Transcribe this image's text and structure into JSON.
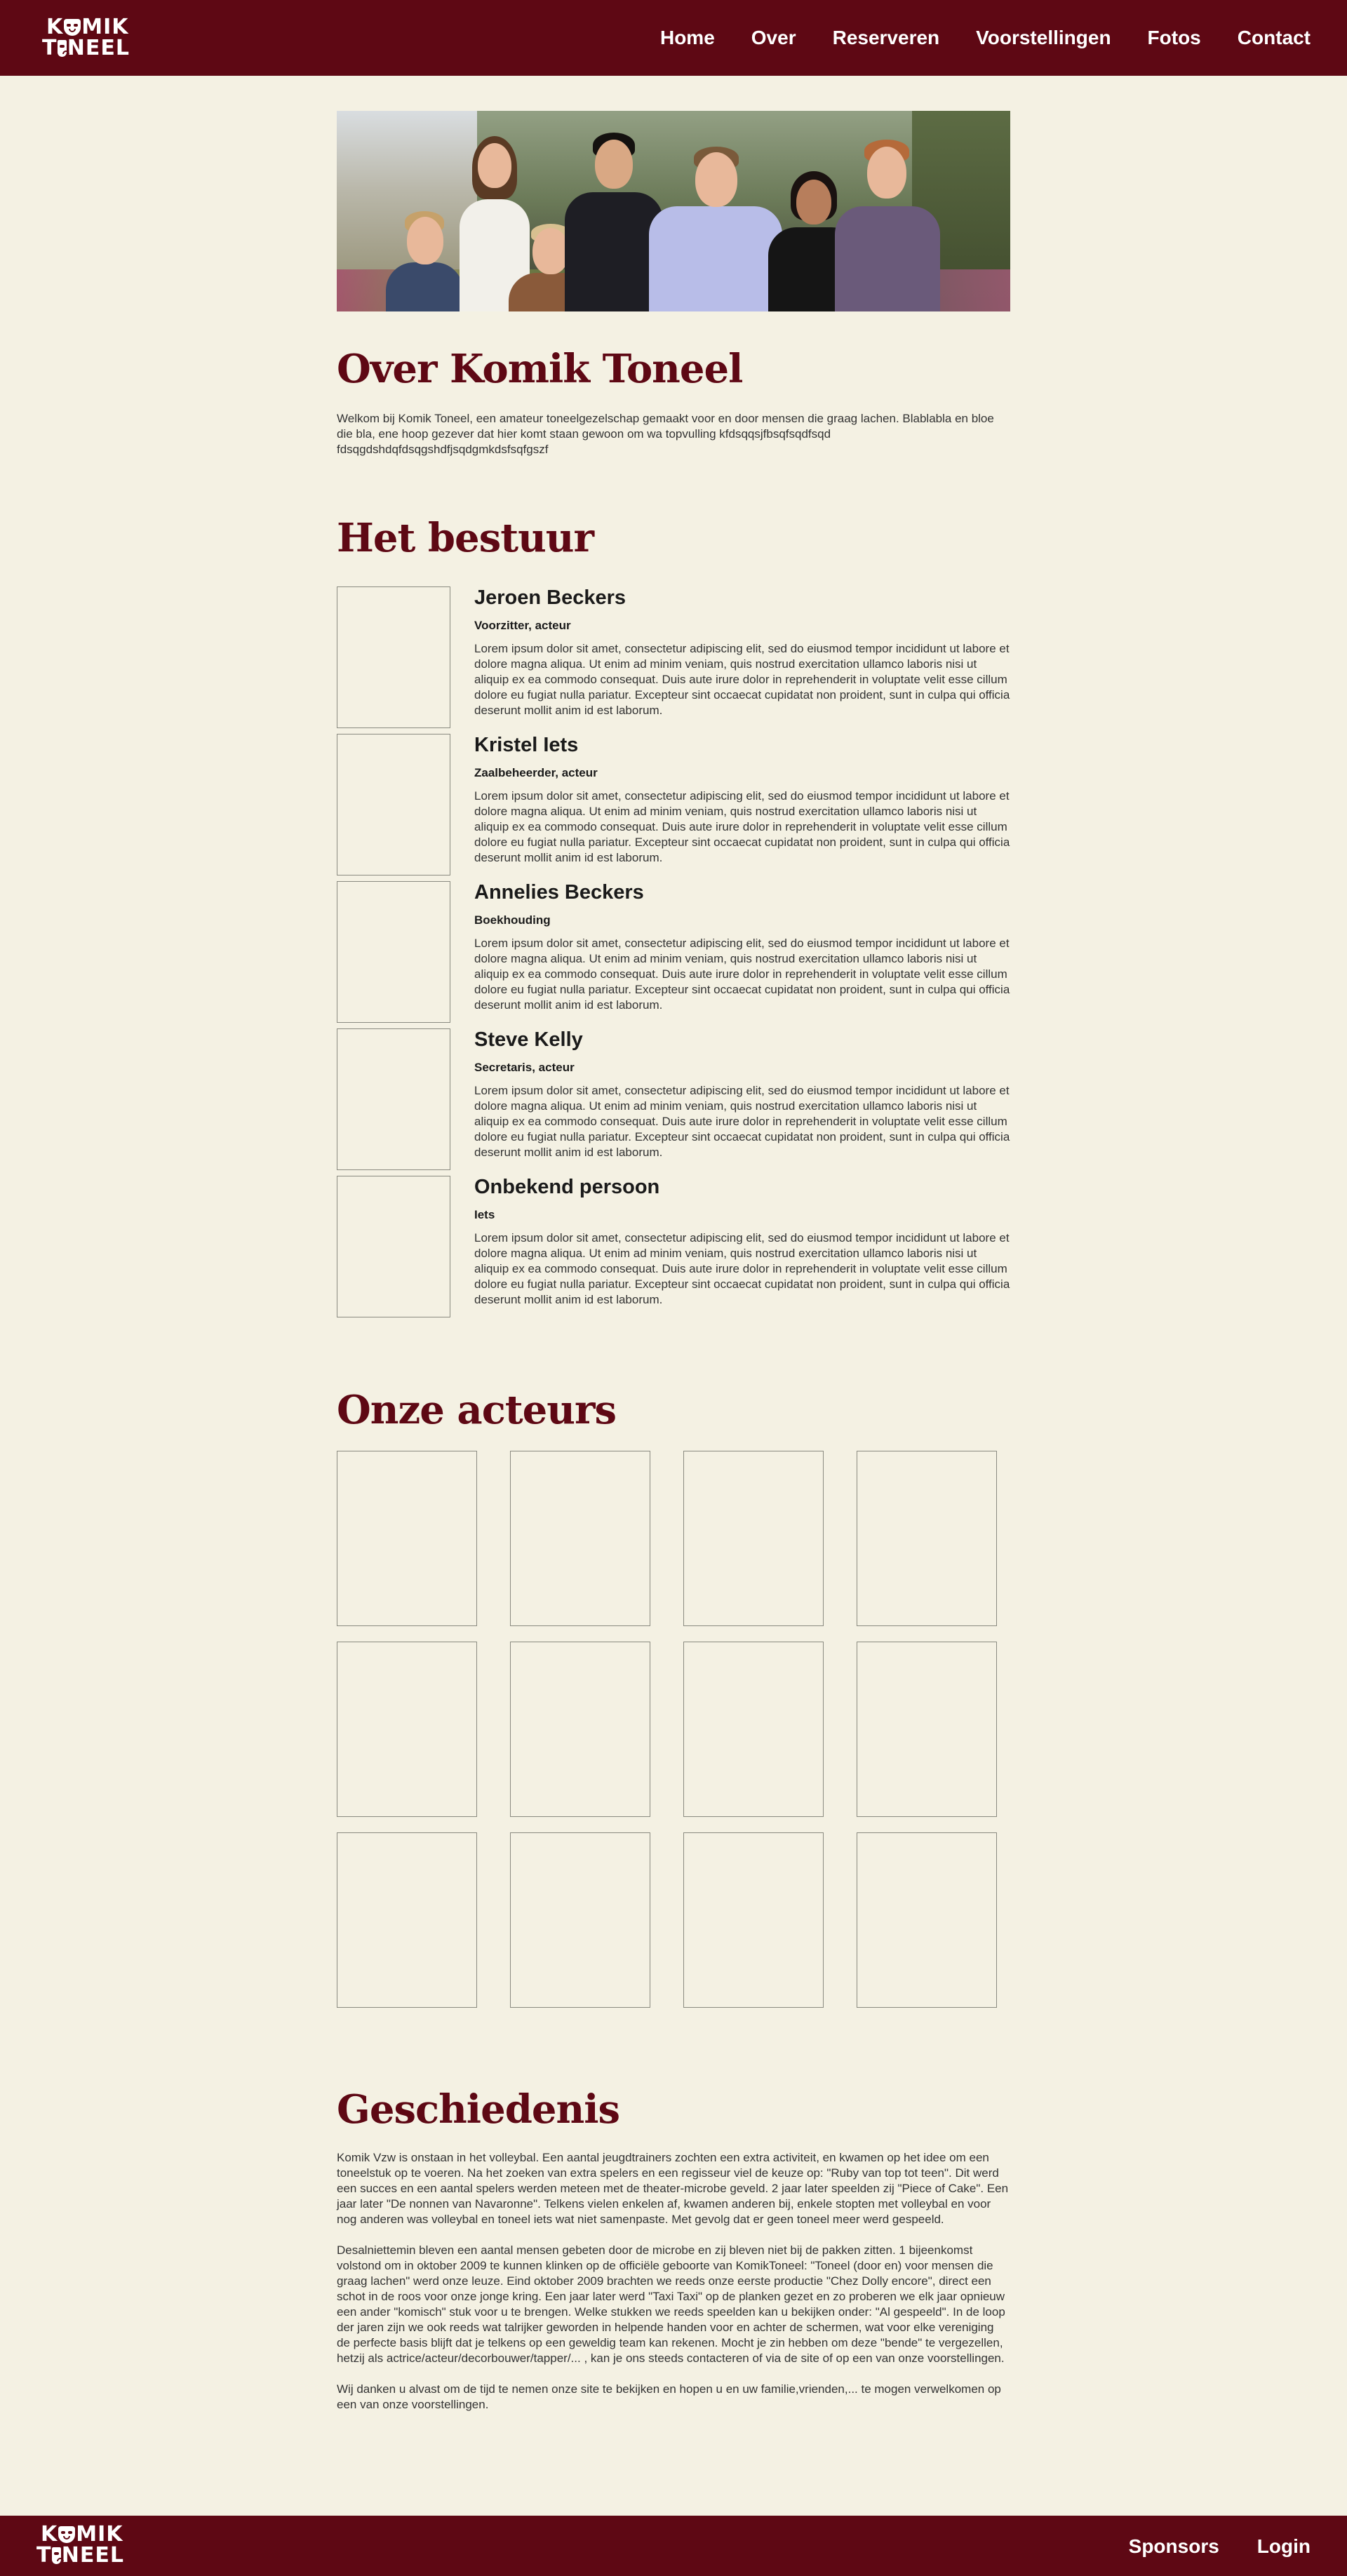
{
  "header": {
    "logo_line1_a": "K",
    "logo_line1_b": "MIK",
    "logo_line2_a": "T",
    "logo_line2_b": "NEEL",
    "nav": [
      "Home",
      "Over",
      "Reserveren",
      "Voorstellingen",
      "Fotos",
      "Contact"
    ]
  },
  "about": {
    "title": "Over Komik Toneel",
    "text": "Welkom bij Komik Toneel, een amateur toneelgezelschap gemaakt voor en door mensen die graag lachen. Blablabla en bloe die bla, ene hoop gezever dat hier komt staan gewoon om wa topvulling kfdsqqsjfbsqfsqdfsqd fdsqgdshdqfdsqgshdfjsqdgmkdsfsqfgszf"
  },
  "board": {
    "title": "Het bestuur",
    "members": [
      {
        "name": "Jeroen Beckers",
        "role": "Voorzitter, acteur",
        "desc": "Lorem ipsum dolor sit amet, consectetur adipiscing elit, sed do eiusmod tempor incididunt ut labore et dolore magna aliqua. Ut enim ad minim veniam, quis nostrud exercitation ullamco laboris nisi ut aliquip ex ea commodo consequat. Duis aute irure dolor in reprehenderit in voluptate velit esse cillum dolore eu fugiat nulla pariatur. Excepteur sint occaecat cupidatat non proident, sunt in culpa qui officia deserunt mollit anim id est laborum."
      },
      {
        "name": "Kristel Iets",
        "role": "Zaalbeheerder, acteur",
        "desc": "Lorem ipsum dolor sit amet, consectetur adipiscing elit, sed do eiusmod tempor incididunt ut labore et dolore magna aliqua. Ut enim ad minim veniam, quis nostrud exercitation ullamco laboris nisi ut aliquip ex ea commodo consequat. Duis aute irure dolor in reprehenderit in voluptate velit esse cillum dolore eu fugiat nulla pariatur. Excepteur sint occaecat cupidatat non proident, sunt in culpa qui officia deserunt mollit anim id est laborum."
      },
      {
        "name": "Annelies Beckers",
        "role": "Boekhouding",
        "desc": "Lorem ipsum dolor sit amet, consectetur adipiscing elit, sed do eiusmod tempor incididunt ut labore et dolore magna aliqua. Ut enim ad minim veniam, quis nostrud exercitation ullamco laboris nisi ut aliquip ex ea commodo consequat. Duis aute irure dolor in reprehenderit in voluptate velit esse cillum dolore eu fugiat nulla pariatur. Excepteur sint occaecat cupidatat non proident, sunt in culpa qui officia deserunt mollit anim id est laborum."
      },
      {
        "name": "Steve Kelly",
        "role": "Secretaris, acteur",
        "desc": "Lorem ipsum dolor sit amet, consectetur adipiscing elit, sed do eiusmod tempor incididunt ut labore et dolore magna aliqua. Ut enim ad minim veniam, quis nostrud exercitation ullamco laboris nisi ut aliquip ex ea commodo consequat. Duis aute irure dolor in reprehenderit in voluptate velit esse cillum dolore eu fugiat nulla pariatur. Excepteur sint occaecat cupidatat non proident, sunt in culpa qui officia deserunt mollit anim id est laborum."
      },
      {
        "name": "Onbekend persoon",
        "role": "Iets",
        "desc": "Lorem ipsum dolor sit amet, consectetur adipiscing elit, sed do eiusmod tempor incididunt ut labore et dolore magna aliqua. Ut enim ad minim veniam, quis nostrud exercitation ullamco laboris nisi ut aliquip ex ea commodo consequat. Duis aute irure dolor in reprehenderit in voluptate velit esse cillum dolore eu fugiat nulla pariatur. Excepteur sint occaecat cupidatat non proident, sunt in culpa qui officia deserunt mollit anim id est laborum."
      }
    ]
  },
  "actors": {
    "title": "Onze acteurs"
  },
  "history": {
    "title": "Geschiedenis",
    "paragraphs": [
      " Komik Vzw is onstaan in het volleybal. Een aantal jeugdtrainers zochten een extra activiteit, en kwamen op het idee om een toneelstuk op te voeren. Na het zoeken van extra spelers en een regisseur viel de keuze op: \"Ruby van top tot teen\". Dit werd een succes en een aantal spelers werden meteen met de theater-microbe geveld. 2 jaar later speelden zij \"Piece of Cake\". Een jaar later \"De nonnen van Navaronne\". Telkens vielen enkelen af, kwamen anderen bij, enkele stopten met volleybal en voor nog anderen was volleybal en toneel iets wat niet samenpaste. Met gevolg dat er geen toneel meer werd gespeeld.",
      "Desalniettemin bleven een aantal mensen gebeten door de microbe en zij bleven niet bij de pakken zitten. 1 bijeenkomst volstond om in oktober 2009 te kunnen klinken op de officiële geboorte van KomikToneel: \"Toneel (door en) voor mensen die graag lachen\" werd onze leuze. Eind oktober 2009 brachten we reeds onze eerste productie \"Chez Dolly encore\", direct een schot in de roos voor onze jonge kring. Een jaar later werd \"Taxi Taxi\" op de planken gezet en zo proberen we elk jaar opnieuw een ander \"komisch\" stuk voor u te brengen. Welke stukken we reeds speelden kan u bekijken onder: \"Al gespeeld\". In de loop der jaren zijn we ook reeds wat talrijker geworden in helpende handen voor en achter de schermen, wat voor elke vereniging de perfecte basis blijft dat je telkens op een geweldig team kan rekenen. Mocht je zin hebben om deze \"bende\" te vergezellen, hetzij als actrice/acteur/decorbouwer/tapper/... , kan je ons steeds contacteren of via de site of op een van onze voorstellingen.",
      "Wij danken u alvast om de tijd te nemen onze site te bekijken en hopen u en uw familie,vrienden,... te mogen verwelkomen op een van onze voorstellingen."
    ]
  },
  "footer": {
    "nav": [
      "Sponsors",
      "Login"
    ]
  },
  "colors": {
    "brand": "#5e0814",
    "background": "#f4f1e3"
  }
}
